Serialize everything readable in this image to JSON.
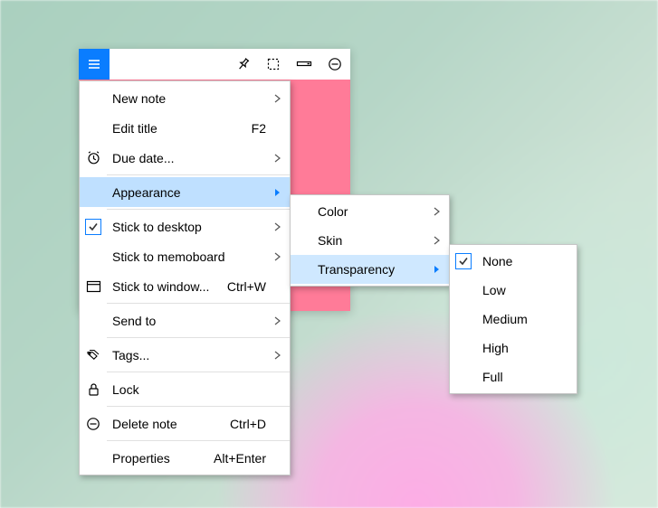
{
  "toolbar": {
    "icons": [
      "menu",
      "pin",
      "select",
      "bar",
      "minus-circle"
    ]
  },
  "main_menu": [
    {
      "label": "New note",
      "arrow": true
    },
    {
      "label": "Edit title",
      "shortcut": "F2"
    },
    {
      "label": "Due date...",
      "icon": "alarm",
      "arrow": true
    },
    "---",
    {
      "label": "Appearance",
      "arrow": true,
      "hover": true
    },
    "---",
    {
      "label": "Stick to desktop",
      "checked": true,
      "arrow": true
    },
    {
      "label": "Stick to memoboard",
      "arrow": true
    },
    {
      "label": "Stick to window...",
      "icon": "window",
      "shortcut": "Ctrl+W"
    },
    "---",
    {
      "label": "Send to",
      "arrow": true
    },
    "---",
    {
      "label": "Tags...",
      "icon": "tags",
      "arrow": true
    },
    "---",
    {
      "label": "Lock",
      "icon": "lock"
    },
    "---",
    {
      "label": "Delete note",
      "icon": "minus-circle",
      "shortcut": "Ctrl+D"
    },
    "---",
    {
      "label": "Properties",
      "shortcut": "Alt+Enter"
    }
  ],
  "appearance_menu": [
    {
      "label": "Color",
      "arrow": true
    },
    {
      "label": "Skin",
      "arrow": true
    },
    {
      "label": "Transparency",
      "arrow": true,
      "hover": true
    }
  ],
  "transparency_menu": [
    {
      "label": "None",
      "checked": true
    },
    {
      "label": "Low"
    },
    {
      "label": "Medium"
    },
    {
      "label": "High"
    },
    {
      "label": "Full"
    }
  ]
}
